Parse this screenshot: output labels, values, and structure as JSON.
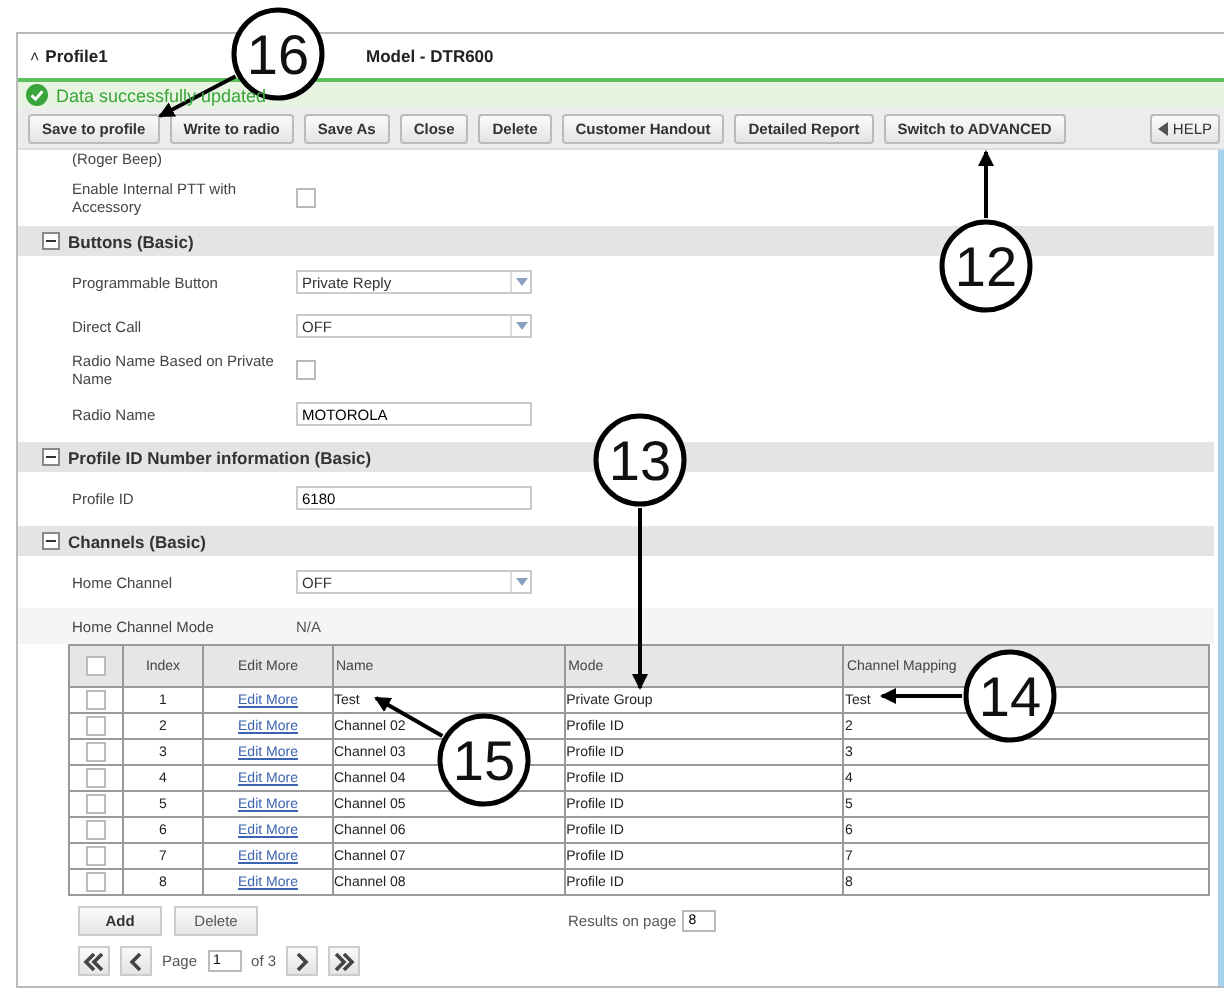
{
  "window": {
    "title": "Profile1",
    "collapse_glyph": "˄",
    "model": "Model - DTR600"
  },
  "message": {
    "text": "Data successfully updated"
  },
  "toolbar": {
    "buttons": [
      "Save to profile",
      "Write to radio",
      "Save As",
      "Close",
      "Delete",
      "Customer Handout",
      "Detailed Report",
      "Switch to ADVANCED"
    ],
    "help": "HELP"
  },
  "sections": [
    {
      "fields": [
        {
          "label": "(Roger Beep)",
          "kind": "cut"
        },
        {
          "label": "Enable Internal PTT with Accessory",
          "kind": "checkbox",
          "checked": false
        }
      ]
    },
    {
      "title": "Buttons (Basic)",
      "expanded": true,
      "fields": [
        {
          "label": "Programmable Button",
          "kind": "select",
          "value": "Private Reply"
        },
        {
          "label": "Direct Call",
          "kind": "select",
          "value": "OFF"
        },
        {
          "label": "Radio Name Based on Private Name",
          "kind": "checkbox",
          "checked": false
        },
        {
          "label": "Radio Name",
          "kind": "text",
          "value": "MOTOROLA"
        }
      ]
    },
    {
      "title": "Profile ID Number information (Basic)",
      "expanded": true,
      "fields": [
        {
          "label": "Profile ID",
          "kind": "text",
          "value": "6180"
        }
      ]
    },
    {
      "title": "Channels (Basic)",
      "expanded": true,
      "fields": [
        {
          "label": "Home Channel",
          "kind": "select",
          "value": "OFF"
        },
        {
          "label": "Home Channel Mode",
          "kind": "readonly",
          "value": "N/A"
        }
      ]
    }
  ],
  "table": {
    "select_all": {
      "checked": false
    },
    "columns": [
      "Index",
      "Edit More",
      "Name",
      "Mode",
      "Channel Mapping"
    ],
    "rows": [
      {
        "checked": false,
        "index": "1",
        "edit": "Edit More",
        "name": "Test",
        "mode": "Private Group",
        "mapping": "Test"
      },
      {
        "checked": false,
        "index": "2",
        "edit": "Edit More",
        "name": "Channel 02",
        "mode": "Profile ID",
        "mapping": "2"
      },
      {
        "checked": false,
        "index": "3",
        "edit": "Edit More",
        "name": "Channel 03",
        "mode": "Profile ID",
        "mapping": "3"
      },
      {
        "checked": false,
        "index": "4",
        "edit": "Edit More",
        "name": "Channel 04",
        "mode": "Profile ID",
        "mapping": "4"
      },
      {
        "checked": false,
        "index": "5",
        "edit": "Edit More",
        "name": "Channel 05",
        "mode": "Profile ID",
        "mapping": "5"
      },
      {
        "checked": false,
        "index": "6",
        "edit": "Edit More",
        "name": "Channel 06",
        "mode": "Profile ID",
        "mapping": "6"
      },
      {
        "checked": false,
        "index": "7",
        "edit": "Edit More",
        "name": "Channel 07",
        "mode": "Profile ID",
        "mapping": "7"
      },
      {
        "checked": false,
        "index": "8",
        "edit": "Edit More",
        "name": "Channel 08",
        "mode": "Profile ID",
        "mapping": "8"
      }
    ]
  },
  "table_actions": [
    "Add",
    "Delete"
  ],
  "results": {
    "label": "Results on page",
    "value": "8"
  },
  "pagination": {
    "label": "Page",
    "page": "1",
    "of": "of 3"
  },
  "callouts": [
    {
      "number": "16"
    },
    {
      "number": "12"
    },
    {
      "number": "13"
    },
    {
      "number": "14"
    },
    {
      "number": "15"
    }
  ]
}
